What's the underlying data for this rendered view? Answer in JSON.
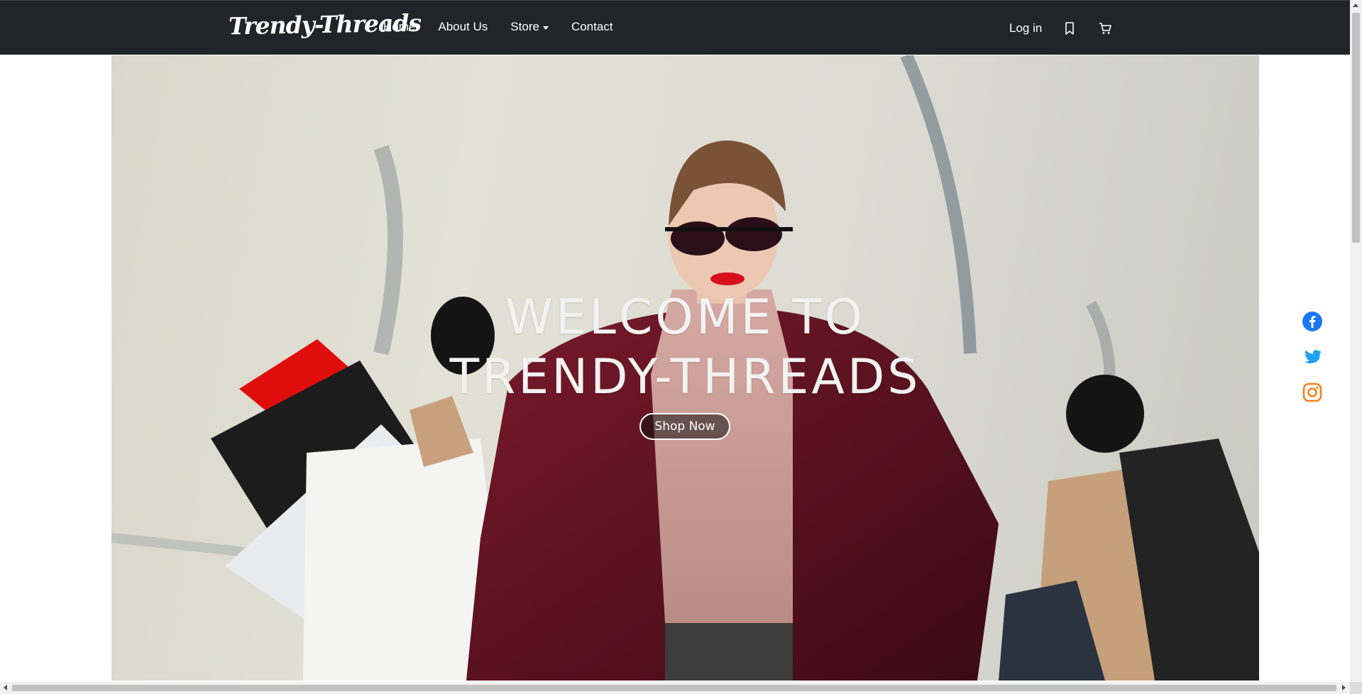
{
  "navbar": {
    "brand": "Trendy-Threads",
    "links": [
      {
        "label": "Home"
      },
      {
        "label": "About Us"
      },
      {
        "label": "Store"
      },
      {
        "label": "Contact"
      }
    ],
    "login_label": "Log in",
    "icons": [
      "bookmark-icon",
      "cart-icon"
    ]
  },
  "hero": {
    "title_line1": "WELCOME TO",
    "title_line2": "TRENDY-THREADS",
    "button_label": "Shop Now"
  },
  "social": [
    "facebook-icon",
    "twitter-icon",
    "instagram-icon"
  ],
  "colors": {
    "navbar_bg": "#212529",
    "facebook": "#1877f2",
    "twitter": "#1da1f2",
    "instagram": "#f77f1b",
    "coat": "#6b1424"
  }
}
